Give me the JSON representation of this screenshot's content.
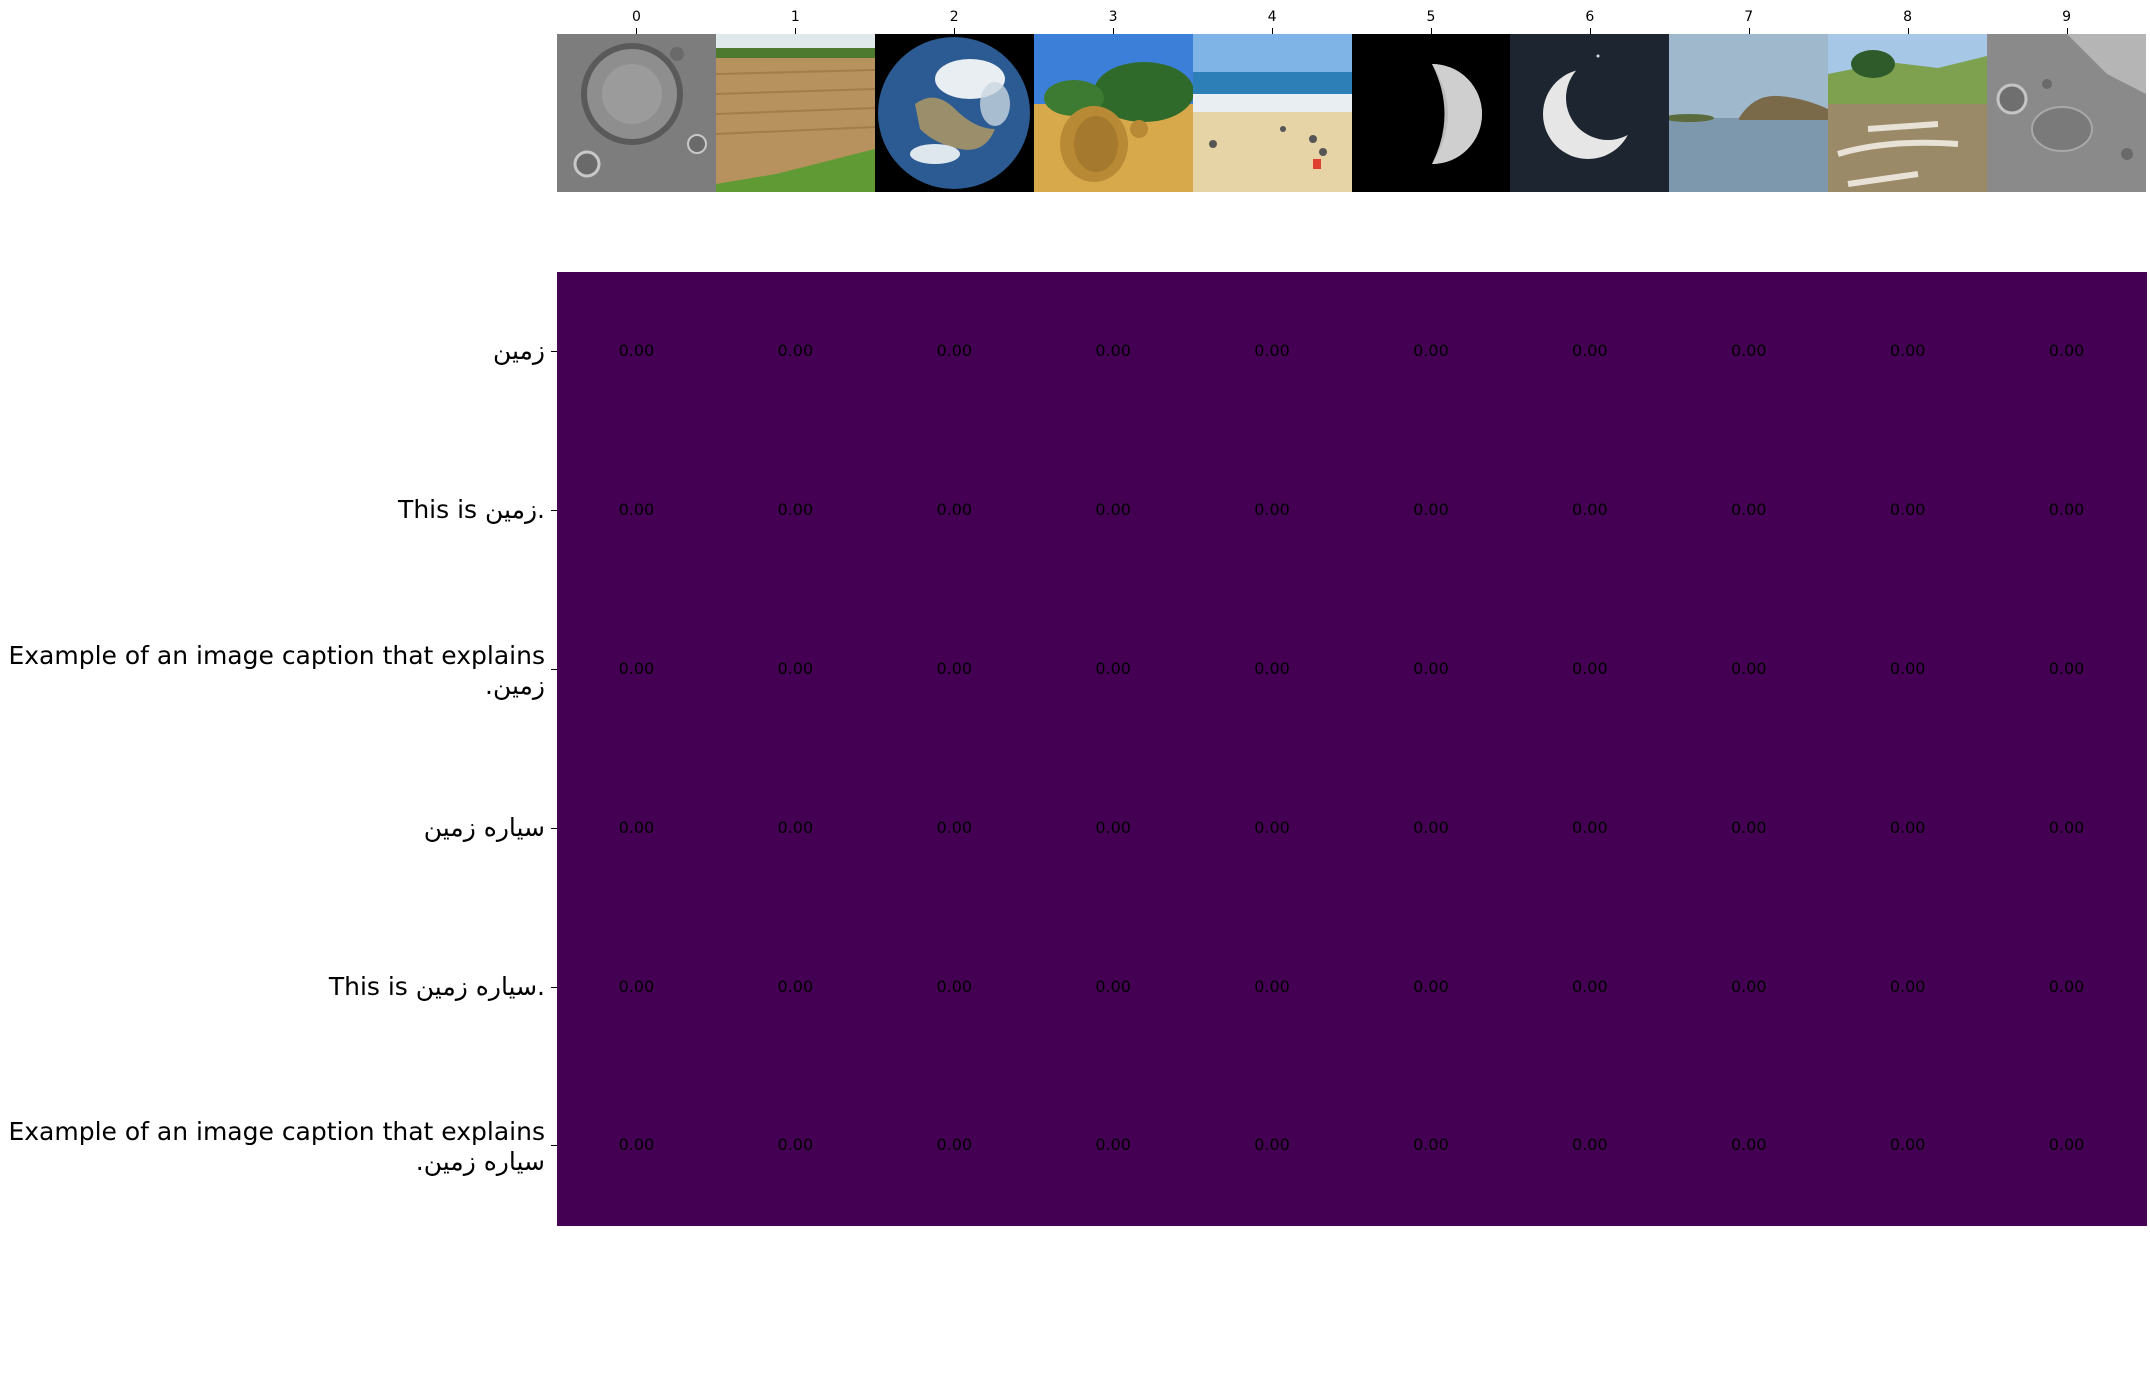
{
  "chart_data": {
    "type": "heatmap",
    "title": "",
    "xlabel": "",
    "ylabel": "",
    "colormap_color": "#440154",
    "columns": [
      "0",
      "1",
      "2",
      "3",
      "4",
      "5",
      "6",
      "7",
      "8",
      "9"
    ],
    "column_images": [
      "moon-crater",
      "plowed-field",
      "earth-globe",
      "hay-bale",
      "beach",
      "half-moon",
      "crescent-moon",
      "lake",
      "hillside-driftwood",
      "lunar-surface"
    ],
    "rows": [
      "زمین",
      "This is زمین.",
      "Example of an image caption that explains\nزمین.",
      "سیاره زمین",
      "This is سیاره زمین.",
      "Example of an image caption that explains\nسیاره زمین."
    ],
    "values": [
      [
        0,
        0,
        0,
        0,
        0,
        0,
        0,
        0,
        0,
        0
      ],
      [
        0,
        0,
        0,
        0,
        0,
        0,
        0,
        0,
        0,
        0
      ],
      [
        0,
        0,
        0,
        0,
        0,
        0,
        0,
        0,
        0,
        0
      ],
      [
        0,
        0,
        0,
        0,
        0,
        0,
        0,
        0,
        0,
        0
      ],
      [
        0,
        0,
        0,
        0,
        0,
        0,
        0,
        0,
        0,
        0
      ],
      [
        0,
        0,
        0,
        0,
        0,
        0,
        0,
        0,
        0,
        0
      ]
    ],
    "value_format": "0.00"
  }
}
